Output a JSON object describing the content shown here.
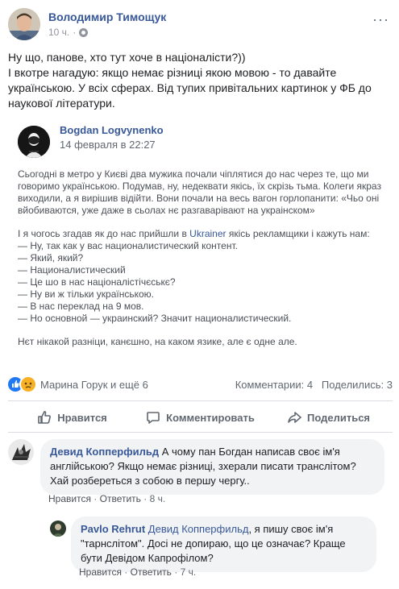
{
  "post": {
    "author": "Володимир Тимощук",
    "time": "10 ч.",
    "separator": "·",
    "more": "···",
    "text": [
      "Ну що, панове, хто тут хоче в націоналісти?))",
      "І вкотре нагадую: якщо немає різниці якою мовою - то давайте українською. У всіх сферах. Від тупих привітальних картинок у ФБ до наукової літератури."
    ]
  },
  "shared": {
    "author": "Bogdan Logvynenko",
    "date": "14 февраля в 22:27",
    "paragraph1": "Сьогодні в метро у Києві два мужика почали чіплятися до нас через те, що ми говоримо українською. Подумав, ну, недеквати якісь, їх скрізь тьма. Колеги якраз виходили, а я вирішив відійти. Вони почали на весь вагон горлопанити: «Чьо оні вйобиваются, уже даже в сьолах нє разгаварівают на украінском»",
    "line_prefix": "І я чогось згадав як до нас прийшли в ",
    "line_link": "Ukrainer",
    "line_suffix": " якісь рекламщики і кажуть нам:",
    "dialogue": [
      "— Ну, так как у вас националистический контент.",
      "— Який, який?",
      "— Националистический",
      "— Це шо в нас націоналістічєськє?",
      "— Ну ви ж тільки українською.",
      "— В нас переклад на 9 мов.",
      "— Но основной — украинский? Значит националистический."
    ],
    "closing": "Нєт нікакой разніци, канєшно, на каком язике, але є одне але."
  },
  "stats": {
    "reactors": "Марина Горук и ещё 6",
    "comments": "Комментарии: 4",
    "shares": "Поделились: 3"
  },
  "actions": {
    "like": "Нравится",
    "comment": "Комментировать",
    "share": "Поделиться"
  },
  "comments": [
    {
      "author": "Девид Копперфильд",
      "text": " А чому пан Богдан написав своє ім'я англійською? Якщо немає різниці, зхерали писати транслітом? Хай розбереться з собою в першу чергу..",
      "like": "Нравится",
      "reply": "Ответить",
      "time": "8 ч."
    },
    {
      "author": "Pavlo Rehrut",
      "tag": " Девид Копперфильд",
      "text": ", я пишу своє ім'я \"тарнслітом\". Досі не допираю, що це означає? Краще бути Девідом Капрофілом?",
      "like": "Нравится",
      "reply": "Ответить",
      "time": "7 ч."
    }
  ],
  "colors": {
    "link": "#385898",
    "like_reaction": "#2078f4",
    "sad_reaction": "#f7b125",
    "bubble": "#f2f3f5"
  }
}
